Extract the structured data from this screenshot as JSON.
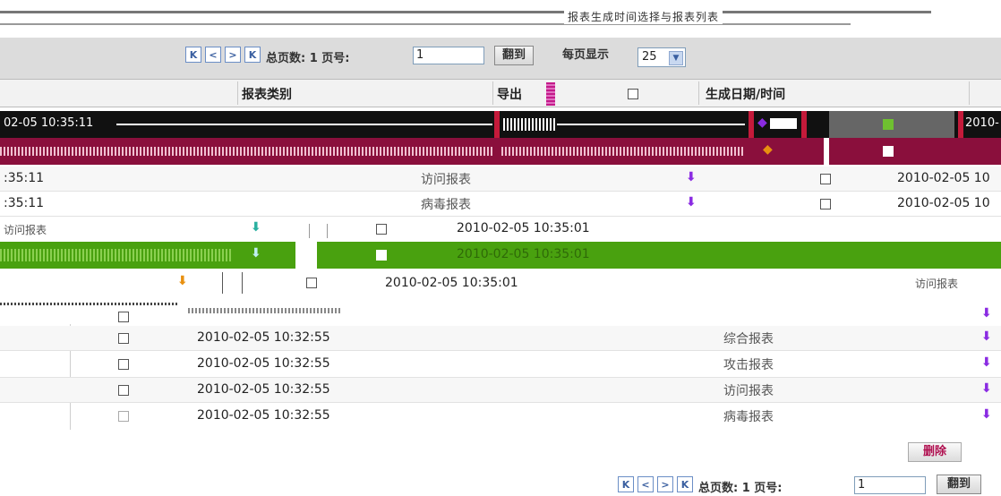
{
  "top_title": "报表生成时间选择与报表列表",
  "toolbar": {
    "nav_first": "K",
    "nav_prev": "<",
    "nav_next": ">",
    "nav_last": "K",
    "total_label": "总页数: 1 页号:",
    "page_value": "1",
    "go_label": "翻到",
    "per_page_label": "每页显示",
    "per_page_value": "25"
  },
  "header": {
    "col_type": "报表类别",
    "col_export": "导出",
    "col_date": "生成日期/时间"
  },
  "rows": {
    "r1_time": "02-05 10:35:11",
    "r1_date": "2010-",
    "r3_time": ":35:11",
    "r3_type": "访问报表",
    "r3_date": "2010-02-05 10",
    "r4_time": ":35:11",
    "r4_type": "病毒报表",
    "r4_date": "2010-02-05 10",
    "r5_type": "访问报表",
    "r5_date": "2010-02-05 10:35:01",
    "r6_date": "2010-02-05 10:35:01",
    "r7_date": "2010-02-05 10:35:01",
    "r7_type": "访问报表",
    "r9_date": "2010-02-05 10:32:55",
    "r9_type": "综合报表",
    "r10_date": "2010-02-05 10:32:55",
    "r10_type": "攻击报表",
    "r11_date": "2010-02-05 10:32:55",
    "r11_type": "访问报表",
    "r12_date": "2010-02-05 10:32:55",
    "r12_type": "病毒报表"
  },
  "footer": {
    "delete_label": "删除",
    "nav_first": "K",
    "nav_prev": "<",
    "nav_next": ">",
    "nav_last": "K",
    "total_label": "总页数: 1 页号:",
    "page_value": "1",
    "go_label": "翻到"
  },
  "colors": {
    "accent_maroon": "#8a0f3c",
    "accent_green": "#49a10f",
    "download_icon": "#8a2be2",
    "nav_border": "#6b8ec6"
  }
}
